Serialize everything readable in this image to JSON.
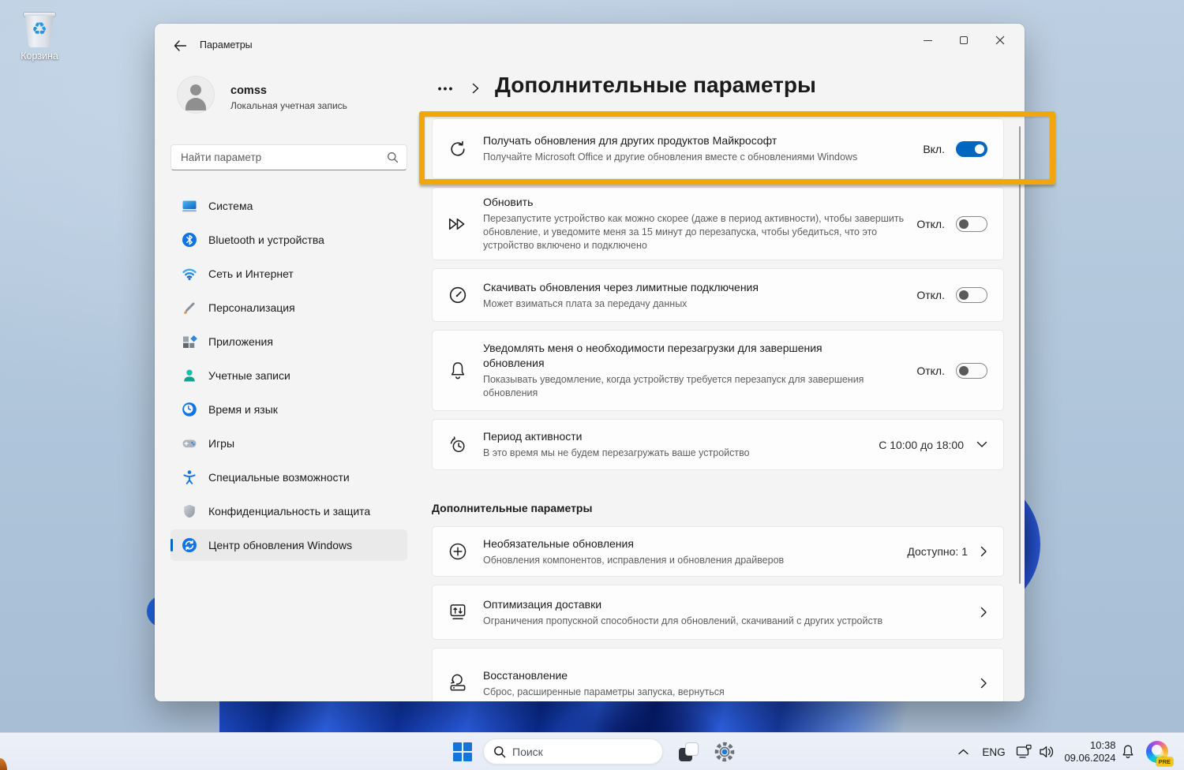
{
  "desktop": {
    "recycle_bin_label": "Корзина"
  },
  "colors": {
    "accent": "#0067C0",
    "highlight_border": "#F2A50C"
  },
  "window": {
    "title": "Параметры",
    "account": {
      "name": "comss",
      "subtitle": "Локальная учетная запись"
    },
    "search": {
      "placeholder": "Найти параметр"
    },
    "nav_items": [
      {
        "label": "Система",
        "icon": "system",
        "selected": false
      },
      {
        "label": "Bluetooth и устройства",
        "icon": "bluetooth",
        "selected": false
      },
      {
        "label": "Сеть и Интернет",
        "icon": "network",
        "selected": false
      },
      {
        "label": "Персонализация",
        "icon": "personalization",
        "selected": false
      },
      {
        "label": "Приложения",
        "icon": "apps",
        "selected": false
      },
      {
        "label": "Учетные записи",
        "icon": "accounts",
        "selected": false
      },
      {
        "label": "Время и язык",
        "icon": "time",
        "selected": false
      },
      {
        "label": "Игры",
        "icon": "gaming",
        "selected": false
      },
      {
        "label": "Специальные возможности",
        "icon": "accessibility",
        "selected": false
      },
      {
        "label": "Конфиденциальность и защита",
        "icon": "privacy",
        "selected": false
      },
      {
        "label": "Центр обновления Windows",
        "icon": "update",
        "selected": true
      }
    ],
    "breadcrumb_ellipsis": "•••",
    "page_title": "Дополнительные параметры",
    "cards_top": [
      {
        "icon": "sync",
        "title": "Получать обновления для других продуктов Майкрософт",
        "subtitle": "Получайте Microsoft Office и другие обновления вместе с обновлениями Windows",
        "state": "Вкл.",
        "toggle": "on",
        "highlighted": true
      },
      {
        "icon": "fast-forward",
        "title": "Обновить",
        "subtitle": "Перезапустите устройство как можно скорее (даже в период активности), чтобы завершить обновление, и уведомите меня за 15 минут до перезапуска, чтобы убедиться, что это устройство включено и подключено",
        "state": "Откл.",
        "toggle": "off"
      },
      {
        "icon": "metered",
        "title": "Скачивать обновления через лимитные подключения",
        "subtitle": "Может взиматься плата за передачу данных",
        "state": "Откл.",
        "toggle": "off"
      },
      {
        "icon": "notify",
        "title": "Уведомлять меня о необходимости перезагрузки для завершения обновления",
        "subtitle": "Показывать уведомление, когда устройству требуется перезапуск для завершения обновления",
        "state": "Откл.",
        "toggle": "off"
      },
      {
        "icon": "active-hours",
        "title": "Период активности",
        "subtitle": "В это время мы не будем перезагружать ваше устройство",
        "value": "С 10:00 до 18:00",
        "chevron": "down"
      }
    ],
    "section_title": "Дополнительные параметры",
    "cards_bottom": [
      {
        "icon": "optional-updates",
        "title": "Необязательные обновления",
        "subtitle": "Обновления компонентов, исправления и обновления драйверов",
        "value": "Доступно: 1",
        "chevron": "right"
      },
      {
        "icon": "delivery",
        "title": "Оптимизация доставки",
        "subtitle": "Ограничения пропускной способности для обновлений, скачиваний с других устройств",
        "chevron": "right"
      },
      {
        "icon": "recovery",
        "title": "Восстановление",
        "subtitle": "Сброс, расширенные параметры запуска, вернуться",
        "chevron": "right"
      }
    ]
  },
  "taskbar": {
    "search_placeholder": "Поиск",
    "tray": {
      "language": "ENG",
      "time": "10:38",
      "date": "09.06.2024",
      "copilot_badge": "PRE"
    }
  }
}
